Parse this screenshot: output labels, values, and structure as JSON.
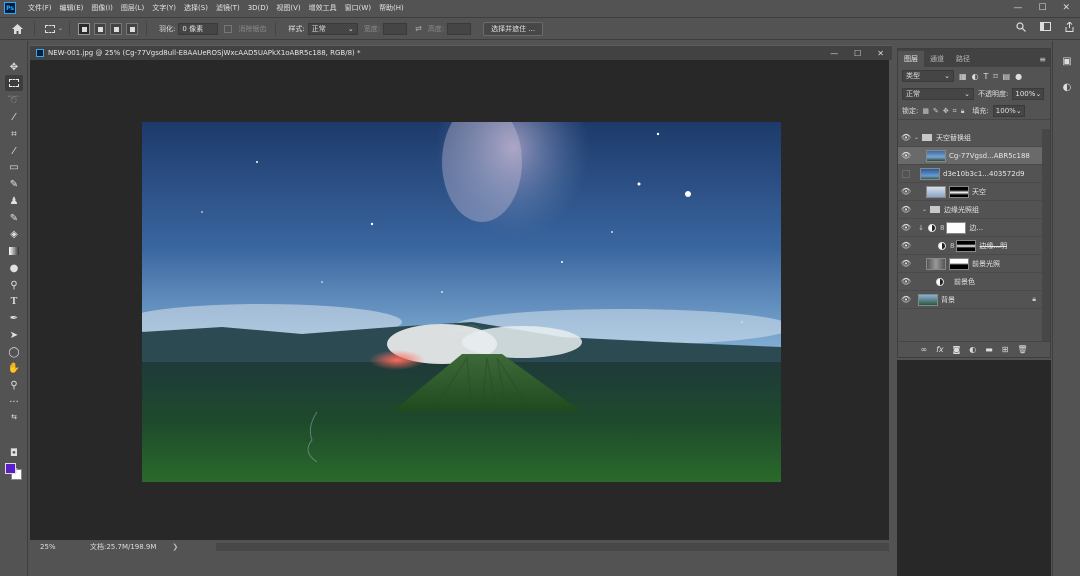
{
  "app": {
    "logo": "Ps"
  },
  "menubar": {
    "items": [
      "文件(F)",
      "编辑(E)",
      "图像(I)",
      "图层(L)",
      "文字(Y)",
      "选择(S)",
      "滤镜(T)",
      "3D(D)",
      "视图(V)",
      "增效工具",
      "窗口(W)",
      "帮助(H)"
    ]
  },
  "window_controls": {
    "minimize": "—",
    "maximize": "☐",
    "close": "✕"
  },
  "options": {
    "feather_label": "羽化:",
    "feather_value": "0 像素",
    "antialias_label": "消除锯齿",
    "style_label": "样式:",
    "style_value": "正常",
    "width_label": "宽度:",
    "height_label": "高度:",
    "select_mask_button": "选择并遮住 ..."
  },
  "document": {
    "title": "NEW-001.jpg @ 25% (Cg-77Vgsd8ull-E8AAUeROSjWxcAAD5UAPkX1oABR5c188, RGB/8) *",
    "zoom": "25%",
    "doc_info": "文档:25.7M/198.9M",
    "status_arrow": "❯"
  },
  "colors": {
    "foreground": "#5a1fc8",
    "background": "#ffffff",
    "ui_bg": "#535353",
    "canvas_bg": "#282828"
  },
  "layers_panel": {
    "tabs": [
      "图层",
      "通道",
      "路径"
    ],
    "filter_type": "类型",
    "blend_mode": "正常",
    "opacity_label": "不透明度:",
    "opacity_value": "100%",
    "lock_label": "锁定:",
    "fill_label": "填充:",
    "fill_value": "100%",
    "layers": [
      {
        "name": "天空替换组",
        "kind": "group"
      },
      {
        "name": "Cg-77Vgsd...ABR5c188",
        "kind": "smart"
      },
      {
        "name": "d3e10b3c1...403572d9",
        "kind": "smart"
      },
      {
        "name": "天空",
        "kind": "masked"
      },
      {
        "name": "边缘光照组",
        "kind": "group"
      },
      {
        "name": "边...",
        "kind": "adjustment"
      },
      {
        "name": "边缘...明",
        "kind": "adjustment"
      },
      {
        "name": "前景光照",
        "kind": "masked"
      },
      {
        "name": "前景色",
        "kind": "adjustment"
      },
      {
        "name": "背景",
        "kind": "background"
      }
    ]
  }
}
